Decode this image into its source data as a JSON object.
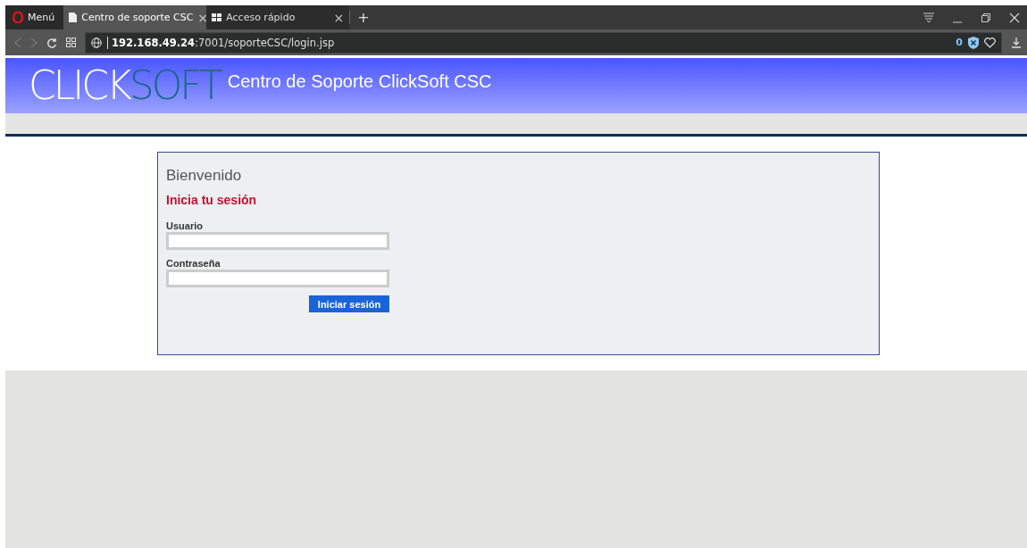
{
  "browser": {
    "menu_label": "Menú",
    "tabs": [
      {
        "title": "Centro de soporte CSC",
        "selected": true,
        "kind": "page",
        "close": "×"
      },
      {
        "title": "Acceso rápido",
        "selected": false,
        "kind": "speed-dial",
        "close": "×"
      }
    ],
    "new_tab": "+",
    "address": "**192.168.49.24**:7001/soporteCSC/login.jsp",
    "blocked_count": "0"
  },
  "header": {
    "logo": [
      "CLICK",
      "SOFT"
    ],
    "title": "Centro de Soporte ClickSoft CSC"
  },
  "login": {
    "greeting": "Bienvenido",
    "heading": "Inicia tu sesión",
    "fields": [
      {
        "label": "Usuario"
      },
      {
        "label": "Contraseña"
      }
    ],
    "submit": "Iniciar sesión"
  }
}
